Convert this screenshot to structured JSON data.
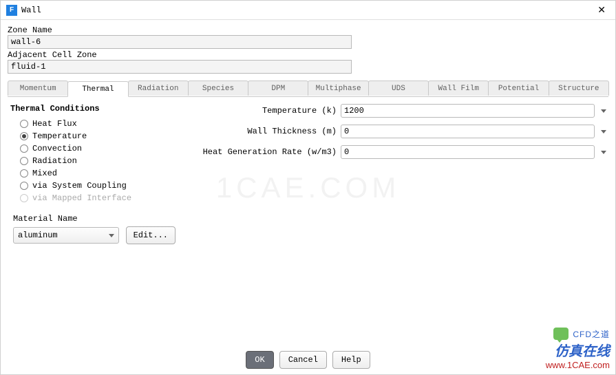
{
  "window": {
    "title": "Wall",
    "icon_letter": "F"
  },
  "zone_name": {
    "label": "Zone Name",
    "value": "wall-6"
  },
  "adj_cell_zone": {
    "label": "Adjacent Cell Zone",
    "value": "fluid-1"
  },
  "tabs": [
    "Momentum",
    "Thermal",
    "Radiation",
    "Species",
    "DPM",
    "Multiphase",
    "UDS",
    "Wall Film",
    "Potential",
    "Structure"
  ],
  "active_tab_index": 1,
  "thermal": {
    "heading": "Thermal Conditions",
    "options": [
      {
        "label": "Heat Flux",
        "selected": false,
        "disabled": false
      },
      {
        "label": "Temperature",
        "selected": true,
        "disabled": false
      },
      {
        "label": "Convection",
        "selected": false,
        "disabled": false
      },
      {
        "label": "Radiation",
        "selected": false,
        "disabled": false
      },
      {
        "label": "Mixed",
        "selected": false,
        "disabled": false
      },
      {
        "label": "via System Coupling",
        "selected": false,
        "disabled": false
      },
      {
        "label": "via Mapped Interface",
        "selected": false,
        "disabled": true
      }
    ],
    "fields": {
      "temperature": {
        "label": "Temperature (k)",
        "value": "1200"
      },
      "wall_thickness": {
        "label": "Wall Thickness (m)",
        "value": "0"
      },
      "heat_gen": {
        "label": "Heat Generation Rate (w/m3)",
        "value": "0"
      }
    }
  },
  "material": {
    "label": "Material Name",
    "value": "aluminum",
    "edit_label": "Edit..."
  },
  "buttons": {
    "ok": "OK",
    "cancel": "Cancel",
    "help": "Help"
  },
  "watermark": "1CAE.COM",
  "overlay": {
    "line1": "CFD之道",
    "line2": "仿真在线",
    "line3": "www.1CAE.com"
  }
}
